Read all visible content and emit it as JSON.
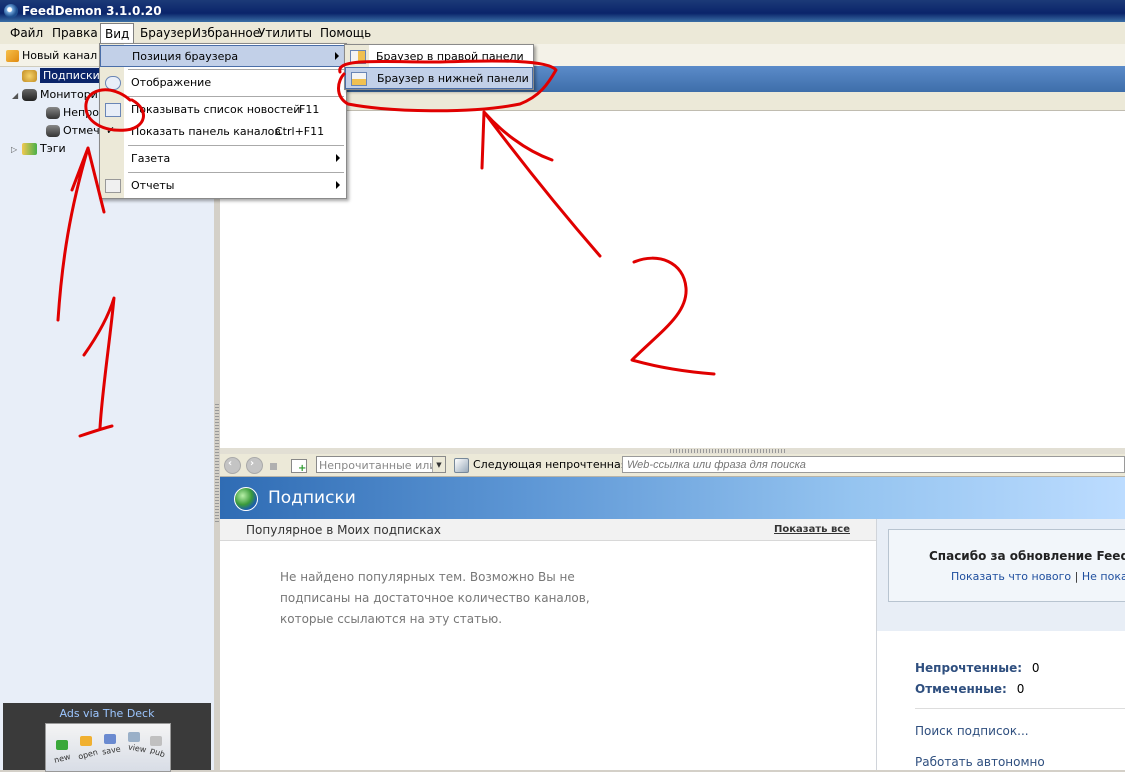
{
  "window": {
    "title": "FeedDemon 3.1.0.20"
  },
  "menubar": [
    "Файл",
    "Правка",
    "Вид",
    "Браузер",
    "Избранное",
    "Утилиты",
    "Помощь"
  ],
  "sidebar": {
    "new_channel": "Новый канал",
    "tree": [
      {
        "label": "Подписки",
        "selected": true
      },
      {
        "label": "Монитори"
      },
      {
        "label": "Непро"
      },
      {
        "label": "Отмече"
      },
      {
        "label": "Тэги"
      }
    ],
    "ad": {
      "text": "Ads via The Deck",
      "icons": [
        "new",
        "open",
        "save",
        "view",
        "pub"
      ]
    }
  },
  "view_menu": {
    "items": [
      {
        "label": "Позиция браузера",
        "submenu": true,
        "highlighted": true
      },
      {
        "label": "Отображение"
      },
      {
        "label": "Показывать список новостей",
        "shortcut": "F11"
      },
      {
        "label": "Показать панель каналов",
        "shortcut": "Ctrl+F11",
        "checked": true
      },
      {
        "label": "Газета",
        "submenu": true
      },
      {
        "label": "Отчеты",
        "submenu": true
      }
    ]
  },
  "browser_position_menu": {
    "items": [
      {
        "label": "Браузер в правой панели"
      },
      {
        "label": "Браузер в нижней панели",
        "highlighted": true
      }
    ]
  },
  "browser_toolbar": {
    "filter_value": "Непрочитанные или с с",
    "next_unread": "Следующая непрочтенная",
    "url_placeholder": "Web-ссылка или фраза для поиска"
  },
  "subscriptions": {
    "title": "Подписки",
    "popular_header": "Популярное в Моих подписках",
    "show_all": "Показать все",
    "empty_text": "Не найдено популярных тем. Возможно Вы не подписаны на достаточное количество каналов, которые ссылаются на эту статью.",
    "thanks_title": "Спасибо за обновление FeedD",
    "thanks_link1": "Показать что нового",
    "thanks_sep": "|",
    "thanks_link2": "Не показыв",
    "unread_label": "Непрочтенные:",
    "unread_count": "0",
    "flagged_label": "Отмеченные:",
    "flagged_count": "0",
    "find_subscriptions": "Поиск подписок...",
    "work_offline": "Работать автономно"
  },
  "annotations": {
    "label1": "1",
    "label2": "2",
    "color": "#e00000"
  },
  "colors": {
    "title_bar": "#0a246a",
    "menu_bg": "#ece9d8",
    "header_blue": "#2f6cb4",
    "annotation_red": "#e00000"
  }
}
